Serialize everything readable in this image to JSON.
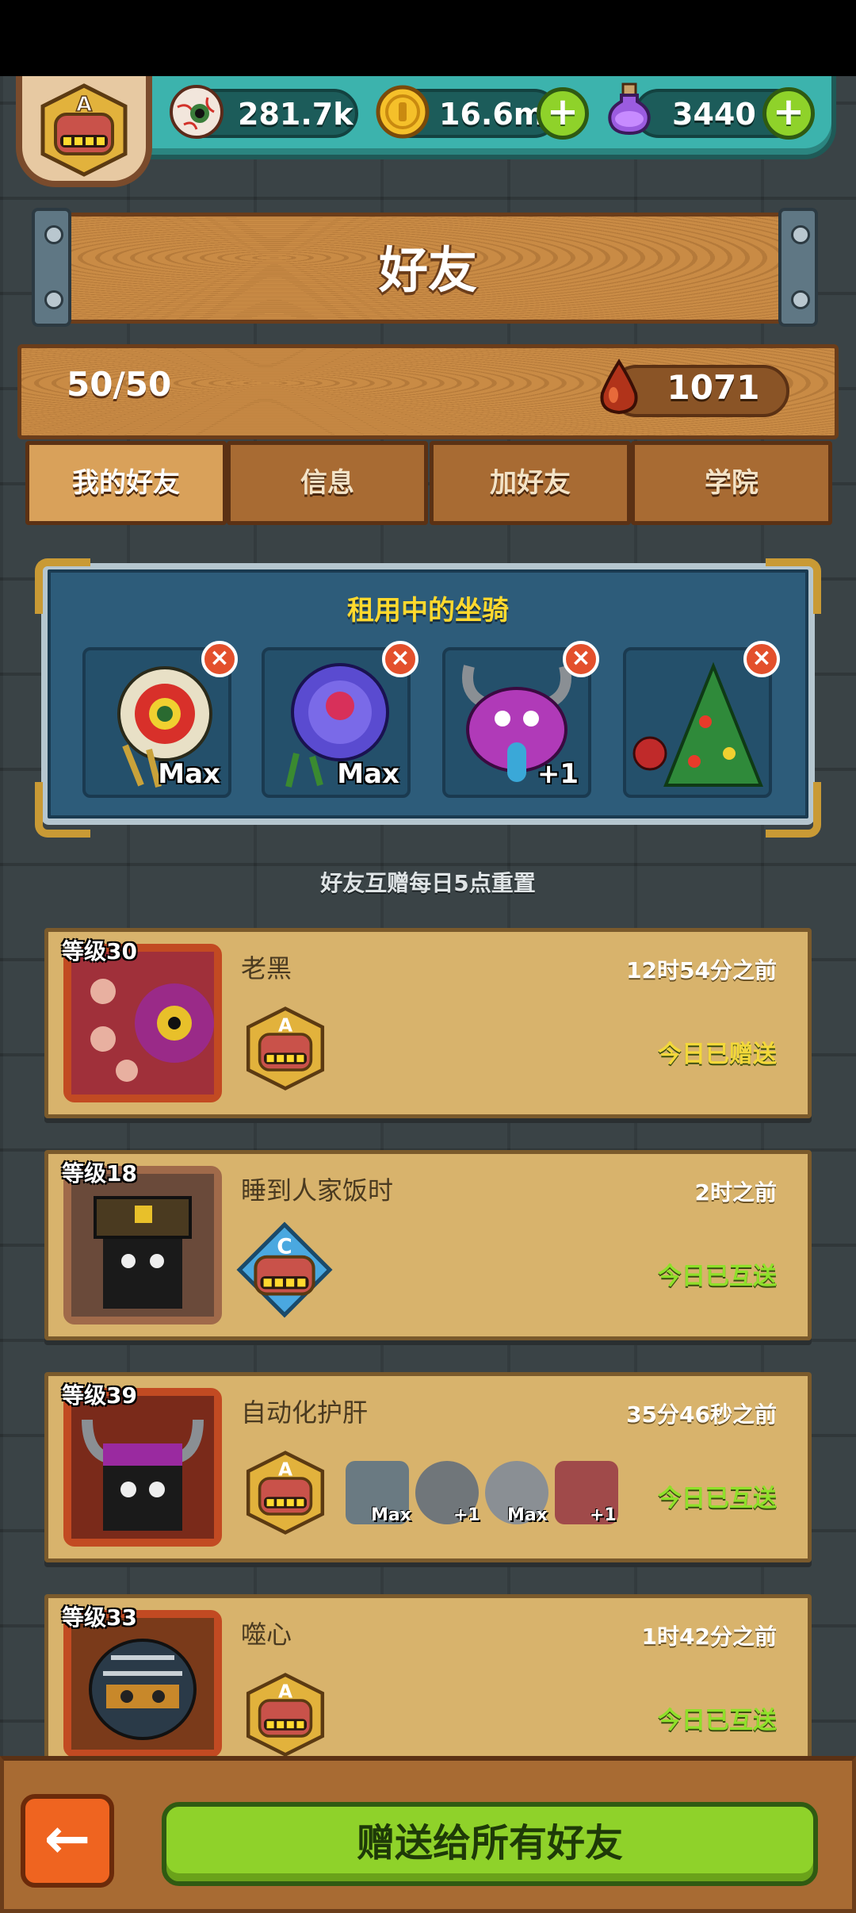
{
  "resources": {
    "eyes": {
      "icon": "eyeball-icon",
      "value": "281.7k"
    },
    "coins": {
      "icon": "coin-icon",
      "value": "16.6m"
    },
    "potions": {
      "icon": "potion-icon",
      "value": "3440"
    },
    "player_rank": "A"
  },
  "title": "好友",
  "friend_count": "50/50",
  "blood": {
    "icon": "blood-drop-icon",
    "value": "1071"
  },
  "tabs": [
    {
      "label": "我的好友",
      "active": true
    },
    {
      "label": "信息",
      "active": false
    },
    {
      "label": "加好友",
      "active": false
    },
    {
      "label": "学院",
      "active": false
    }
  ],
  "rent": {
    "title": "租用中的坐骑",
    "mounts": [
      {
        "name": "lion-dance-mount",
        "label": "Max"
      },
      {
        "name": "rose-mount",
        "label": "Max"
      },
      {
        "name": "purple-demon-mount",
        "label": "+1"
      },
      {
        "name": "christmas-tree-mount",
        "label": ""
      }
    ]
  },
  "reset_note": "好友互赠每日5点重置",
  "friends": [
    {
      "level": "等级30",
      "name": "老黑",
      "time": "12时54分之前",
      "status": "今日已赠送",
      "status_color": "#f3d83a",
      "rank": "A",
      "mounts": []
    },
    {
      "level": "等级18",
      "name": "睡到人家饭时",
      "time": "2时之前",
      "status": "今日已互送",
      "status_color": "#8fe02a",
      "rank": "C",
      "mounts": []
    },
    {
      "level": "等级39",
      "name": "自动化护肝",
      "time": "35分46秒之前",
      "status": "今日已互送",
      "status_color": "#8fe02a",
      "rank": "A",
      "mounts": [
        {
          "label": "Max"
        },
        {
          "label": "+1"
        },
        {
          "label": "Max"
        },
        {
          "label": "+1"
        }
      ]
    },
    {
      "level": "等级33",
      "name": "噬心",
      "time": "1时42分之前",
      "status": "今日已互送",
      "status_color": "#8fe02a",
      "rank": "A",
      "mounts": []
    }
  ],
  "bottom": {
    "back_icon": "arrow-left-icon",
    "gift_all_label": "赠送给所有好友"
  }
}
